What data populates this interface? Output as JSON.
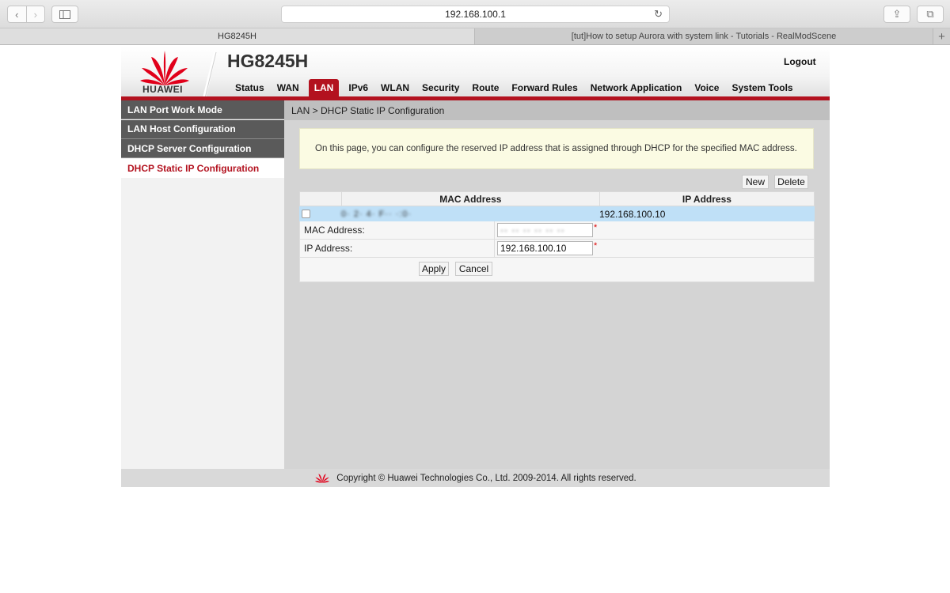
{
  "browser": {
    "url": "192.168.100.1",
    "nav_back": "‹",
    "nav_forward": "›",
    "reload_icon": "↻",
    "share_icon": "⇪",
    "tabs_icon": "⧉",
    "tabs": [
      {
        "title": "HG8245H"
      },
      {
        "title": "[tut]How to setup Aurora with system link - Tutorials - RealModScene"
      }
    ],
    "new_tab": "+"
  },
  "header": {
    "brand": "HUAWEI",
    "model": "HG8245H",
    "logout": "Logout",
    "menu": [
      "Status",
      "WAN",
      "LAN",
      "IPv6",
      "WLAN",
      "Security",
      "Route",
      "Forward Rules",
      "Network Application",
      "Voice",
      "System Tools"
    ],
    "active_menu": "LAN",
    "accent_color": "#b3121f"
  },
  "sidebar": {
    "items": [
      {
        "label": "LAN Port Work Mode"
      },
      {
        "label": "LAN Host Configuration"
      },
      {
        "label": "DHCP Server Configuration"
      },
      {
        "label": "DHCP Static IP Configuration"
      }
    ],
    "active": "DHCP Static IP Configuration"
  },
  "main": {
    "breadcrumb": "LAN > DHCP Static IP Configuration",
    "notice": "On this page, you can configure the reserved IP address that is assigned through DHCP for the specified MAC address.",
    "new_label": "New",
    "delete_label": "Delete",
    "table": {
      "headers": [
        "MAC Address",
        "IP Address"
      ],
      "rows": [
        {
          "mac": "0(redacted)",
          "mac_display": "0· 2· 4· F·· ·:0·",
          "ip": "192.168.100.10",
          "checked": false
        }
      ]
    },
    "form": {
      "mac_label": "MAC Address:",
      "mac_value": "(redacted)",
      "mac_display": "·· ·· ·· ·· ·· ··",
      "ip_label": "IP Address:",
      "ip_value": "192.168.100.10",
      "required_mark": "*",
      "apply_label": "Apply",
      "cancel_label": "Cancel"
    }
  },
  "footer": {
    "copyright": "Copyright © Huawei Technologies Co., Ltd. 2009-2014. All rights reserved."
  }
}
